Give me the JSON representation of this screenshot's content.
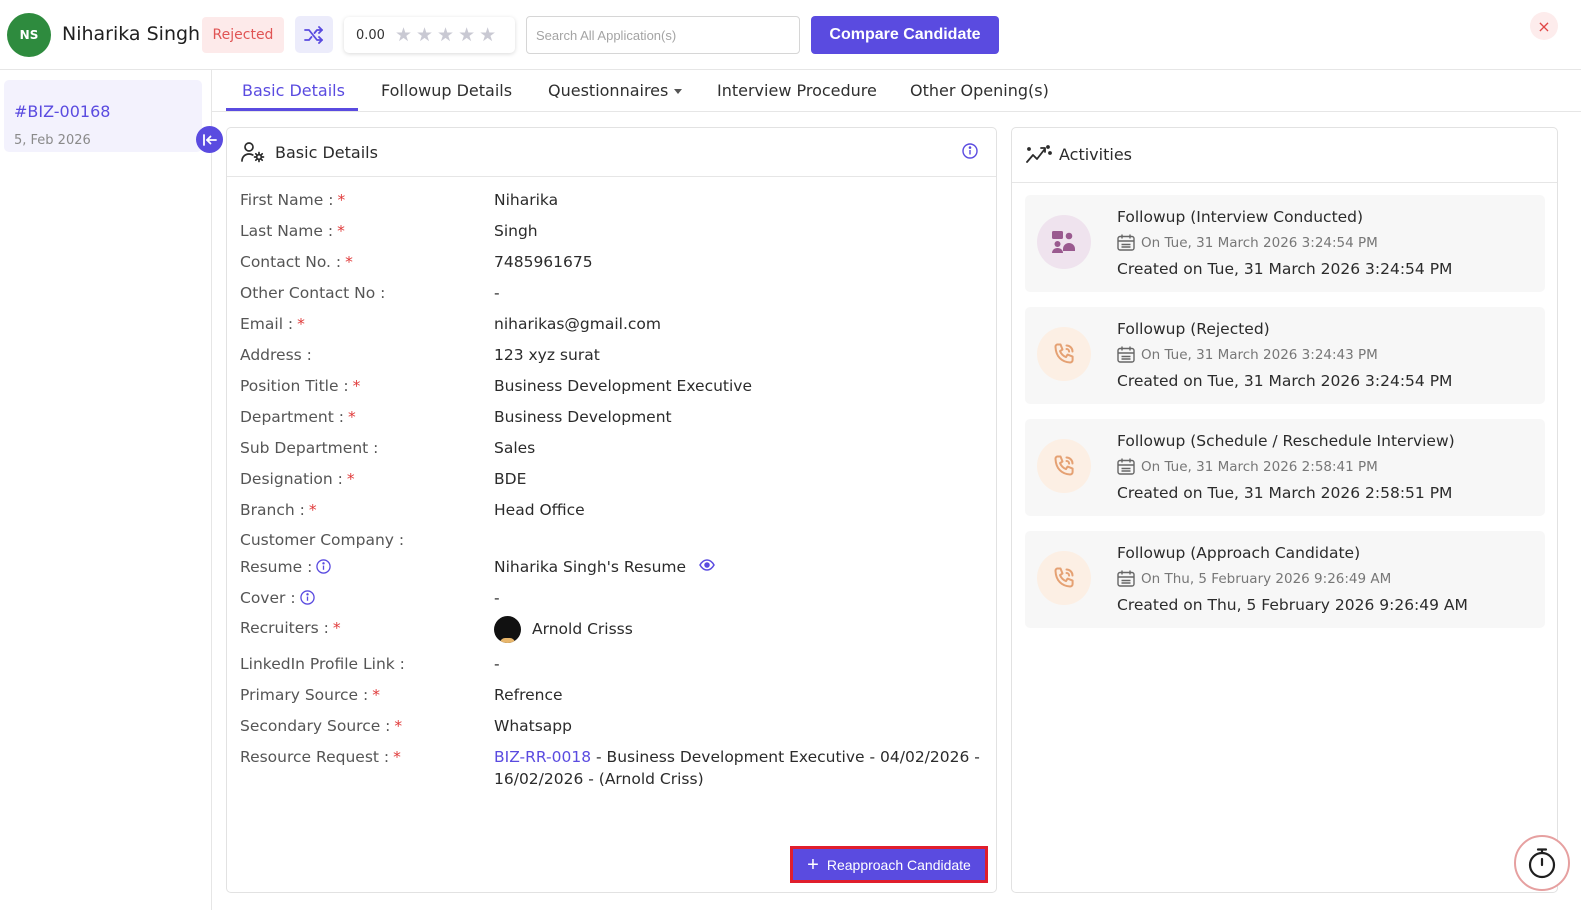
{
  "header": {
    "avatar_initials": "NS",
    "candidate_name": "Niharika Singh",
    "status": "Rejected",
    "rating": "0.00",
    "stars_total": 5,
    "stars_filled": 0,
    "search_placeholder": "Search All Application(s)",
    "compare_label": "Compare Candidate",
    "close_label": "×"
  },
  "sidebar": {
    "application_id": "#BIZ-00168",
    "application_date": "5, Feb 2026"
  },
  "tabs": [
    "Basic Details",
    "Followup Details",
    "Questionnaires",
    "Interview Procedure",
    "Other Opening(s)"
  ],
  "basic_details": {
    "title": "Basic Details",
    "fields": [
      {
        "label": "First Name :",
        "required": "*",
        "value": "Niharika"
      },
      {
        "label": "Last Name :",
        "required": "*",
        "value": "Singh"
      },
      {
        "label": "Contact No. :",
        "required": "*",
        "value": "7485961675"
      },
      {
        "label": "Other Contact No :",
        "required": "",
        "value": "-"
      },
      {
        "label": "Email :",
        "required": "*",
        "value": "niharikas@gmail.com"
      },
      {
        "label": "Address :",
        "required": "",
        "value": "123 xyz surat"
      },
      {
        "label": "Position Title :",
        "required": "*",
        "value": "Business Development Executive"
      },
      {
        "label": "Department :",
        "required": "*",
        "value": "Business Development"
      },
      {
        "label": "Sub Department :",
        "required": "",
        "value": "Sales"
      },
      {
        "label": "Designation :",
        "required": "*",
        "value": "BDE"
      },
      {
        "label": "Branch :",
        "required": "*",
        "value": "Head Office"
      },
      {
        "label": "Customer Company :",
        "required": "",
        "value": ""
      },
      {
        "label": "Resume :",
        "required": "",
        "value": "Niharika Singh's Resume"
      },
      {
        "label": "Cover :",
        "required": "",
        "value": "-"
      },
      {
        "label": "Recruiters :",
        "required": "*",
        "value": "Arnold Crisss"
      },
      {
        "label": "LinkedIn Profile Link :",
        "required": "",
        "value": "-"
      },
      {
        "label": "Primary Source :",
        "required": "*",
        "value": "Refrence"
      },
      {
        "label": "Secondary Source :",
        "required": "*",
        "value": "Whatsapp"
      },
      {
        "label": "Resource Request :",
        "required": "*",
        "value": ""
      }
    ],
    "resource_request": {
      "link_text": "BIZ-RR-0018",
      "line1_rest": " - Business Development Executive - 04/02/2026 -",
      "line2": "16/02/2026 - (Arnold Criss)"
    },
    "reapproach_label": "Reapproach Candidate"
  },
  "activities": {
    "title": "Activities",
    "items": [
      {
        "title": "Followup (Interview Conducted)",
        "date": "On Tue, 31 March 2026 3:24:54 PM",
        "created": "Created on Tue, 31 March 2026 3:24:54 PM",
        "icon": "interview-icon"
      },
      {
        "title": "Followup (Rejected)",
        "date": "On Tue, 31 March 2026 3:24:43 PM",
        "created": "Created on Tue, 31 March 2026 3:24:54 PM",
        "icon": "phone-icon"
      },
      {
        "title": "Followup (Schedule / Reschedule Interview)",
        "date": "On Tue, 31 March 2026 2:58:41 PM",
        "created": "Created on Tue, 31 March 2026 2:58:51 PM",
        "icon": "phone-icon"
      },
      {
        "title": "Followup (Approach Candidate)",
        "date": "On Thu, 5 February 2026 9:26:49 AM",
        "created": "Created on Thu, 5 February 2026 9:26:49 AM",
        "icon": "phone-icon"
      }
    ]
  },
  "colors": {
    "accent": "#5a4be0",
    "rejected": "#e05454",
    "avatar": "#2e8b3e"
  }
}
